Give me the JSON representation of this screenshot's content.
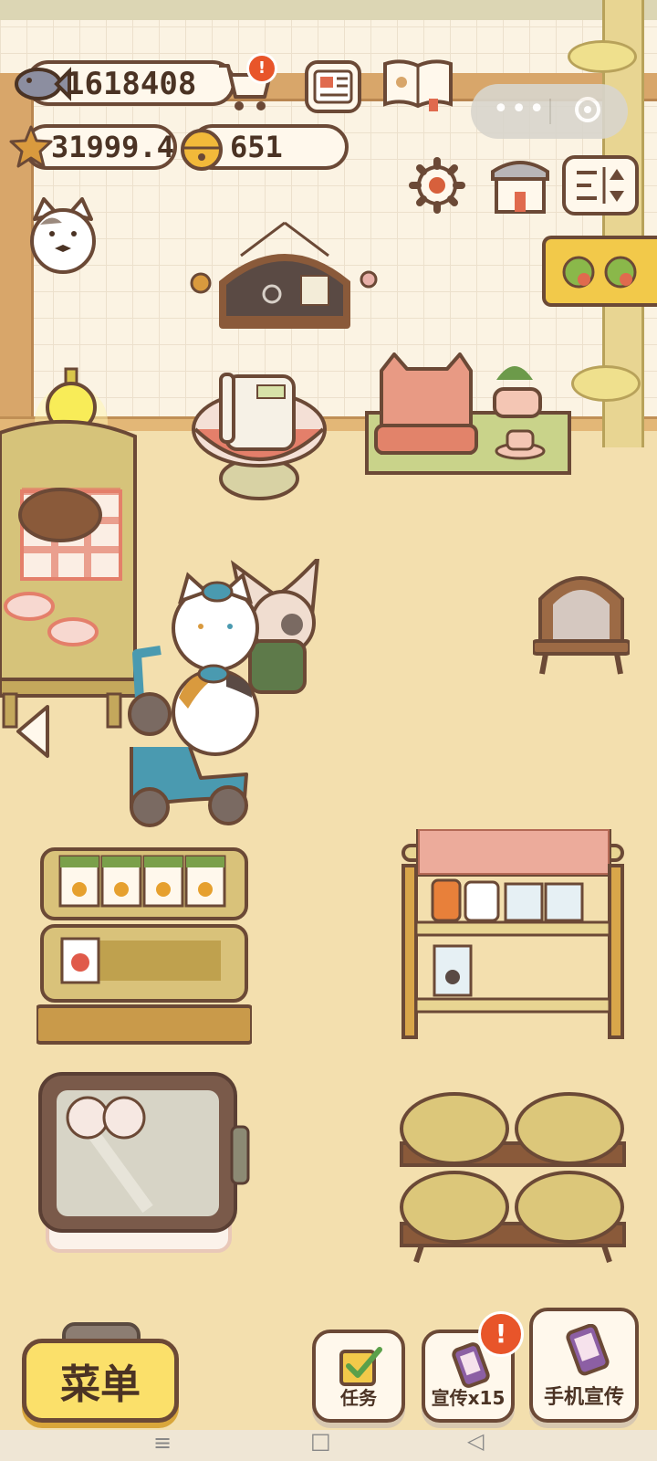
{
  "hud": {
    "fish_count": "1618408",
    "star_count": "31999.4",
    "bell_count": "651",
    "cart_alert": "!",
    "promo_alert": "!"
  },
  "bottom": {
    "menu_label": "菜单",
    "tasks_label": "任务",
    "promo_label": "宣传x15",
    "phone_promo_label": "手机宣传"
  },
  "navbar": {
    "menu_icon": "≡",
    "home_icon": "□",
    "back_icon": "◁"
  },
  "icons": [
    "fish-icon",
    "cart-icon",
    "newspaper-icon",
    "recipe-book-icon",
    "star-icon",
    "bell-icon",
    "settings-gear-icon",
    "shop-icon",
    "sort-icon",
    "cat-avatar-icon",
    "chalkboard-icon",
    "telephone-icon",
    "lamp-icon",
    "left-arrow-icon",
    "check-icon"
  ],
  "colors": {
    "alert": "#e8552a",
    "outline": "#6b4936",
    "menu_button": "#fbe06a"
  }
}
